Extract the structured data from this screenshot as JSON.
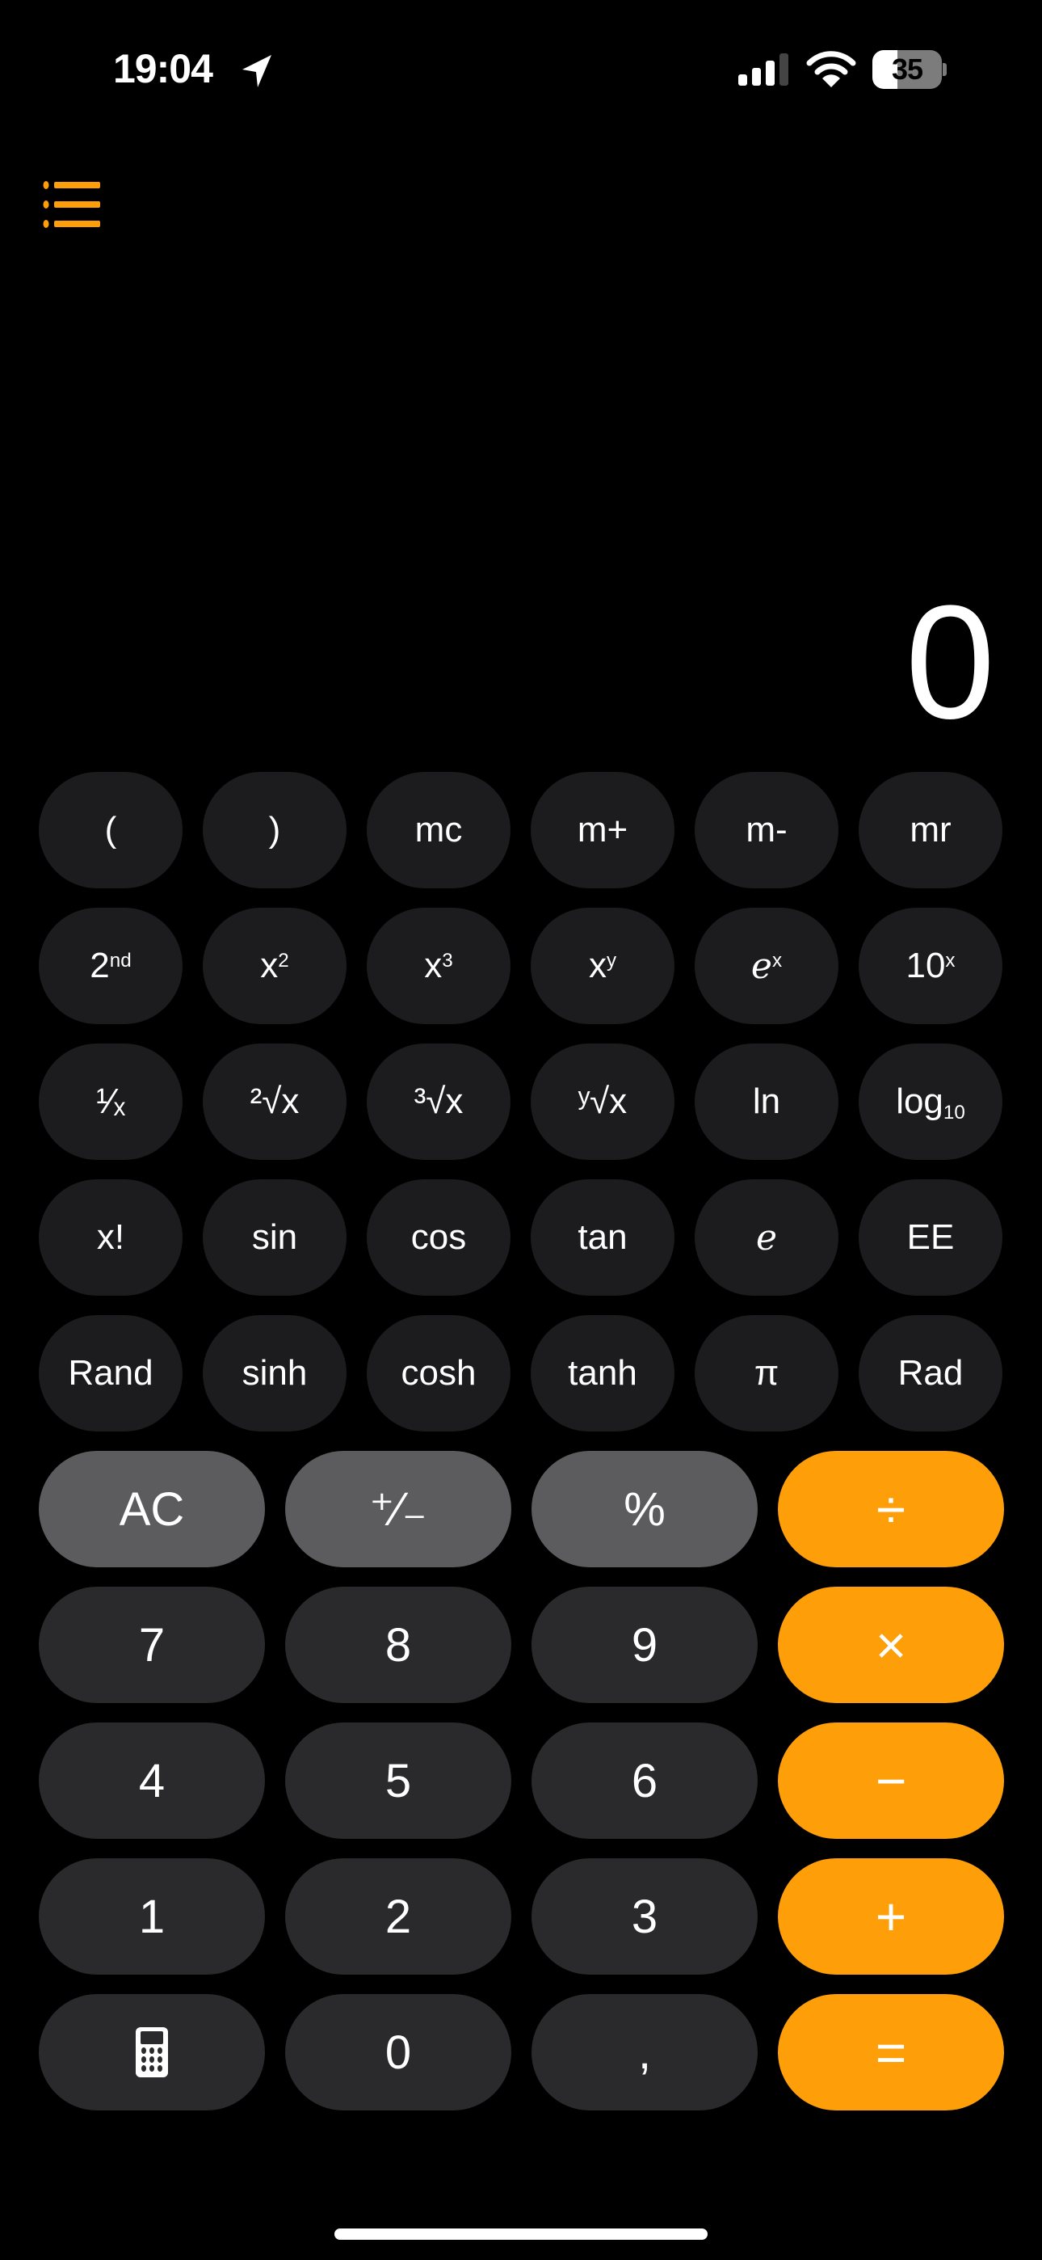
{
  "status_bar": {
    "time": "19:04",
    "location_icon": "location-arrow-icon",
    "signal_icon": "cellular-signal-icon",
    "signal_bars_active": 3,
    "signal_bars_total": 4,
    "wifi_icon": "wifi-icon",
    "battery_percent": "35",
    "battery_fraction": 0.35
  },
  "toolbar": {
    "history_icon": "list-bullet-icon"
  },
  "display": {
    "value": "0"
  },
  "colors": {
    "background": "#000000",
    "scientific_key": "#1c1c1e",
    "digit_key": "#2a2a2c",
    "function_key": "#5c5c5e",
    "operator_key": "#fe9f0a",
    "accent": "#fe9f0a",
    "text": "#ffffff"
  },
  "scientific_keys": {
    "row1": [
      {
        "label": "(",
        "id": "open-paren"
      },
      {
        "label": ")",
        "id": "close-paren"
      },
      {
        "label": "mc",
        "id": "memory-clear"
      },
      {
        "label": "m+",
        "id": "memory-add"
      },
      {
        "label": "m-",
        "id": "memory-subtract"
      },
      {
        "label": "mr",
        "id": "memory-recall"
      }
    ],
    "row2": [
      {
        "base": "2",
        "sup": "nd",
        "id": "second-function"
      },
      {
        "base": "x",
        "sup": "2",
        "id": "square"
      },
      {
        "base": "x",
        "sup": "3",
        "id": "cube"
      },
      {
        "base": "x",
        "sup": "y",
        "id": "power"
      },
      {
        "base": "e",
        "sup": "x",
        "id": "exp"
      },
      {
        "base": "10",
        "sup": "x",
        "id": "ten-power"
      }
    ],
    "row3": [
      {
        "label": "¹⁄ₓ",
        "id": "reciprocal"
      },
      {
        "label": "²√x",
        "id": "square-root"
      },
      {
        "label": "³√x",
        "id": "cube-root"
      },
      {
        "label": "ʸ√x",
        "id": "yth-root"
      },
      {
        "label": "ln",
        "id": "natural-log"
      },
      {
        "base": "log",
        "sub": "10",
        "id": "log10"
      }
    ],
    "row4": [
      {
        "label": "x!",
        "id": "factorial"
      },
      {
        "label": "sin",
        "id": "sin"
      },
      {
        "label": "cos",
        "id": "cos"
      },
      {
        "label": "tan",
        "id": "tan"
      },
      {
        "label": "e",
        "id": "euler"
      },
      {
        "label": "EE",
        "id": "ee"
      }
    ],
    "row5": [
      {
        "label": "Rand",
        "id": "rand"
      },
      {
        "label": "sinh",
        "id": "sinh"
      },
      {
        "label": "cosh",
        "id": "cosh"
      },
      {
        "label": "tanh",
        "id": "tanh"
      },
      {
        "label": "π",
        "id": "pi"
      },
      {
        "label": "Rad",
        "id": "rad"
      }
    ]
  },
  "main_keys": {
    "row1": [
      {
        "label": "AC",
        "id": "all-clear"
      },
      {
        "label": "⁺⁄₋",
        "id": "plus-minus"
      },
      {
        "label": "%",
        "id": "percent"
      },
      {
        "label": "÷",
        "id": "divide"
      }
    ],
    "row2": [
      {
        "label": "7",
        "id": "digit-7"
      },
      {
        "label": "8",
        "id": "digit-8"
      },
      {
        "label": "9",
        "id": "digit-9"
      },
      {
        "label": "×",
        "id": "multiply"
      }
    ],
    "row3": [
      {
        "label": "4",
        "id": "digit-4"
      },
      {
        "label": "5",
        "id": "digit-5"
      },
      {
        "label": "6",
        "id": "digit-6"
      },
      {
        "label": "−",
        "id": "subtract"
      }
    ],
    "row4": [
      {
        "label": "1",
        "id": "digit-1"
      },
      {
        "label": "2",
        "id": "digit-2"
      },
      {
        "label": "3",
        "id": "digit-3"
      },
      {
        "label": "+",
        "id": "add"
      }
    ],
    "row5": [
      {
        "icon": "calculator-icon",
        "id": "calculator-mode"
      },
      {
        "label": "0",
        "id": "digit-0"
      },
      {
        "label": ",",
        "id": "decimal-separator"
      },
      {
        "label": "=",
        "id": "equals"
      }
    ]
  }
}
